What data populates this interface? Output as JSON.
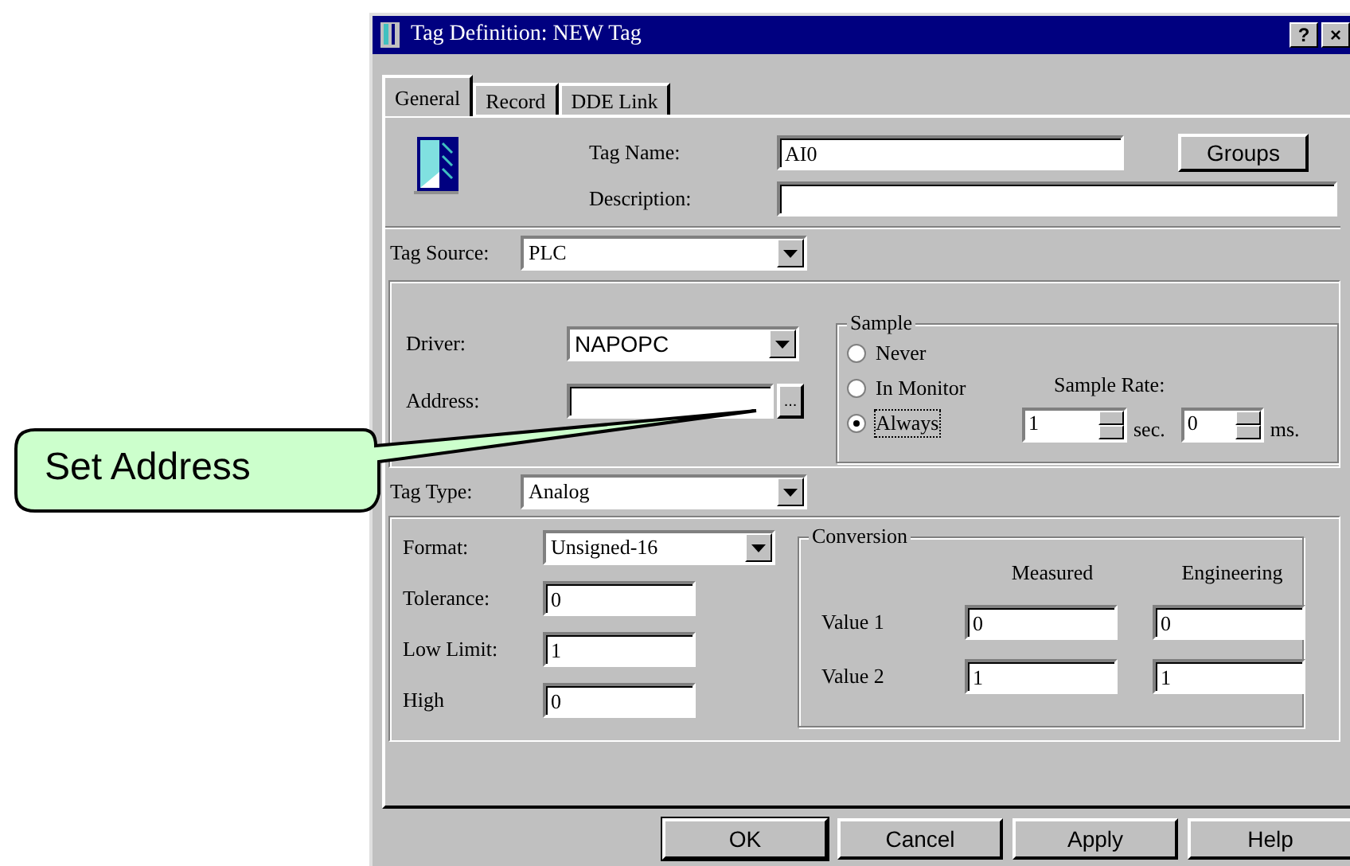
{
  "window": {
    "title": "Tag Definition: NEW Tag",
    "buttons": [
      {
        "kind": "help",
        "label": "?"
      },
      {
        "kind": "close",
        "label": "×"
      }
    ]
  },
  "tabs": [
    {
      "label": "General",
      "selected": true
    },
    {
      "label": "Record",
      "selected": false
    },
    {
      "label": "DDE Link",
      "selected": false
    }
  ],
  "tag_name": {
    "label": "Tag Name:",
    "value": "AI0"
  },
  "groups_button": "Groups",
  "description": {
    "label": "Description:"
  },
  "tag_source": {
    "label": "Tag Source:",
    "value": "PLC"
  },
  "driver": {
    "label": "Driver:",
    "value": "NAPOPC"
  },
  "address": {
    "label": "Address:",
    "button": "..."
  },
  "sample": {
    "title": "Sample",
    "options": [
      {
        "label": "Never",
        "selected": false
      },
      {
        "label": "In Monitor",
        "selected": false
      },
      {
        "label": "Always",
        "selected": true
      }
    ],
    "rate_label": "Sample Rate:",
    "spinners": [
      {
        "value": "1",
        "unit": "sec."
      },
      {
        "value": "0",
        "unit": "ms."
      }
    ]
  },
  "tag_type": {
    "label": "Tag Type:",
    "value": "Analog"
  },
  "format": {
    "label": "Format:",
    "value": "Unsigned-16"
  },
  "fields": [
    {
      "label": "Tolerance:",
      "value": "0"
    },
    {
      "label": "Low Limit:",
      "value": "1"
    },
    {
      "label": "High",
      "value": "0"
    }
  ],
  "conversion": {
    "title": "Conversion",
    "columns": [
      "Measured",
      "Engineering"
    ],
    "rows": [
      {
        "label": "Value 1",
        "values": [
          "0",
          "0"
        ]
      },
      {
        "label": "Value 2",
        "values": [
          "1",
          "1"
        ]
      }
    ]
  },
  "buttons": [
    {
      "label": "OK",
      "default": true
    },
    {
      "label": "Cancel",
      "default": false
    },
    {
      "label": "Apply",
      "default": false
    },
    {
      "label": "Help",
      "default": false
    }
  ],
  "callout": {
    "text": "Set Address"
  }
}
